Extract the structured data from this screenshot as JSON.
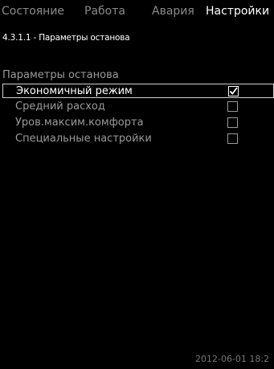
{
  "tabs": [
    {
      "label": "Состояние",
      "active": false
    },
    {
      "label": "Работа",
      "active": false
    },
    {
      "label": "Авария",
      "active": false
    },
    {
      "label": "Настройки",
      "active": true
    }
  ],
  "breadcrumb": "4.3.1.1 - Параметры останова",
  "section_title": "Параметры останова",
  "options": [
    {
      "label": "Экономичный режим",
      "checked": true,
      "selected": true
    },
    {
      "label": "Средний расход",
      "checked": false,
      "selected": false
    },
    {
      "label": "Уров.максим.комфорта",
      "checked": false,
      "selected": false
    },
    {
      "label": "Специальные настройки",
      "checked": false,
      "selected": false
    }
  ],
  "timestamp": "2012-06-01 18:2",
  "colors": {
    "background": "#000000",
    "active_text": "#ffffff",
    "inactive_text": "#9a9a9a"
  },
  "icons": {
    "checked": "checkmark-icon"
  }
}
